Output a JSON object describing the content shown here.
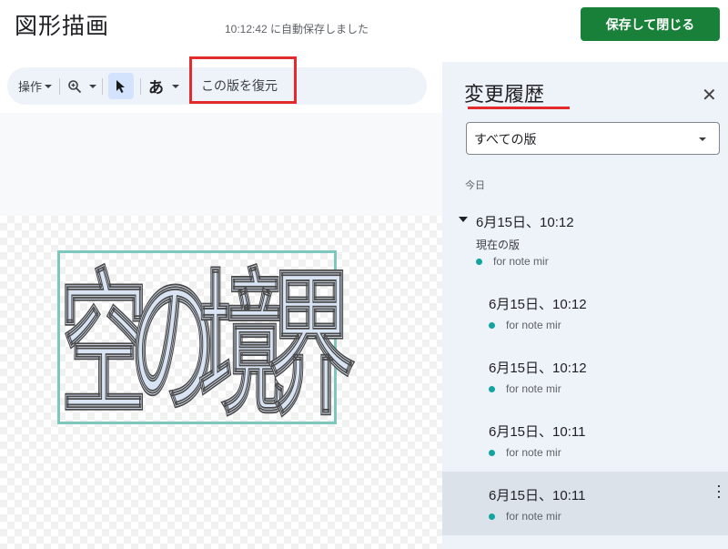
{
  "header": {
    "title": "図形描画",
    "autosave": "10:12:42 に自動保存しました",
    "save_close_label": "保存して閉じる"
  },
  "toolbar": {
    "actions_label": "操作",
    "zoom_icon": "zoom-icon",
    "select_icon": "cursor-icon",
    "text_label": "あ",
    "restore_label": "この版を復元"
  },
  "drawing": {
    "characters": [
      "空",
      "の",
      "境",
      "界"
    ]
  },
  "panel": {
    "title": "変更履歴",
    "filter_label": "すべての版",
    "section": "今日",
    "versions": [
      {
        "time": "6月15日、10:12",
        "sub": "現在の版",
        "user": "for note mir"
      },
      {
        "time": "6月15日、10:12",
        "user": "for note mir"
      },
      {
        "time": "6月15日、10:12",
        "user": "for note mir"
      },
      {
        "time": "6月15日、10:11",
        "user": "for note mir"
      },
      {
        "time": "6月15日、10:11",
        "user": "for note mir"
      }
    ]
  },
  "colors": {
    "accent_green": "#188038",
    "annotation_red": "#e32b2b",
    "user_dot": "#12a4a0"
  }
}
